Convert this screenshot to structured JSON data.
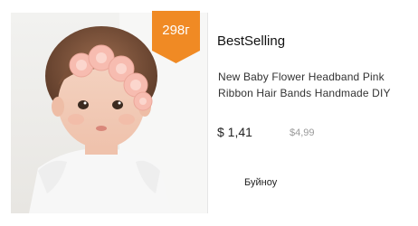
{
  "badge": {
    "text": "298г",
    "color": "#f08a24"
  },
  "section": {
    "title": "BestSelling"
  },
  "product": {
    "title": "New Baby Flower Headband Pink Ribbon Hair Bands Handmade DIY",
    "price": "$ 1,41",
    "old_price": "$4,99",
    "seller": "Буйноу",
    "image_alt": "baby-with-flower-headband"
  }
}
